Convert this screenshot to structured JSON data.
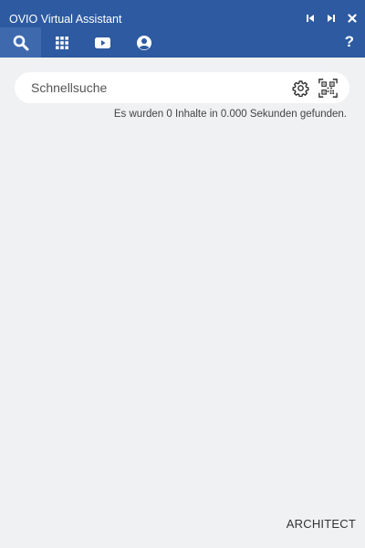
{
  "window": {
    "title": "OVIO Virtual Assistant"
  },
  "window_controls": [
    {
      "icon": "skip-previous-icon"
    },
    {
      "icon": "skip-next-icon"
    },
    {
      "icon": "close-icon"
    }
  ],
  "nav": {
    "tabs": [
      {
        "icon": "search-icon",
        "active": true
      },
      {
        "icon": "grid-icon",
        "active": false
      },
      {
        "icon": "video-camera-icon",
        "active": false
      },
      {
        "icon": "user-account-icon",
        "active": false
      }
    ],
    "help_label": "?"
  },
  "search": {
    "placeholder": "Schnellsuche",
    "value": "",
    "settings_icon": "gear-icon",
    "qr_icon": "qr-code-scan-icon"
  },
  "status": {
    "text": "Es wurden 0 Inhalte in 0.000 Sekunden gefunden."
  },
  "footer": {
    "label": "ARCHITECT"
  },
  "colors": {
    "header_bg": "#2d5aa0",
    "active_tab_bg": "#3e6aad",
    "body_bg": "#f0f1f3",
    "search_bg": "#ffffff"
  }
}
